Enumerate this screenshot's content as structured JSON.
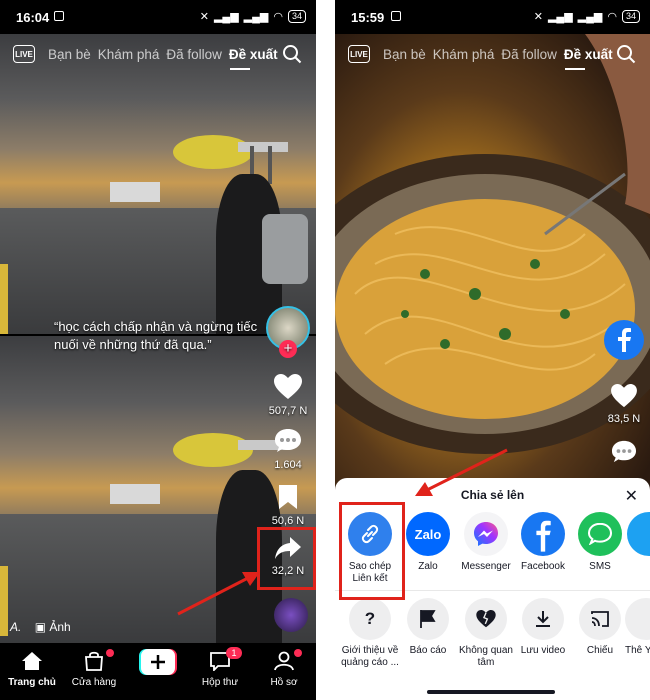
{
  "left": {
    "status": {
      "time": "16:04",
      "battery": "34"
    },
    "nav": {
      "live": "LIVE",
      "tabs": [
        "Bạn bè",
        "Khám phá",
        "Đã follow",
        "Đề xuất"
      ]
    },
    "caption": "“học cách chấp nhận và ngừng tiếc nuối về những thứ đã qua.”",
    "likes": "507,7 N",
    "comments": "1.604",
    "saves": "50,6 N",
    "shares": "32,2 N",
    "photo_label": "Ảnh",
    "author_initial": "A.",
    "bottom": {
      "home": "Trang chủ",
      "shop": "Cửa hàng",
      "inbox": "Hộp thư",
      "inbox_badge": "1",
      "profile": "Hồ sơ"
    }
  },
  "right": {
    "status": {
      "time": "15:59",
      "battery": "34"
    },
    "nav": {
      "live": "LIVE",
      "tabs": [
        "Bạn bè",
        "Khám phá",
        "Đã follow",
        "Đề xuất"
      ]
    },
    "likes": "83,5 N",
    "sheet": {
      "title": "Chia sẻ lên",
      "share": [
        {
          "label": "Sao chép Liên kết"
        },
        {
          "label": "Zalo"
        },
        {
          "label": "Messenger"
        },
        {
          "label": "Facebook"
        },
        {
          "label": "SMS"
        }
      ],
      "actions": [
        {
          "label": "Giới thiệu về quảng cáo ..."
        },
        {
          "label": "Báo cáo"
        },
        {
          "label": "Không quan tâm"
        },
        {
          "label": "Lưu video"
        },
        {
          "label": "Chiếu"
        },
        {
          "label": "Thê Yê"
        }
      ]
    }
  },
  "colors": {
    "highlight": "#e0231b",
    "accent": "#fe2c55",
    "facebook": "#1877f2",
    "zalo": "#0068ff",
    "sms": "#1fc05b"
  }
}
